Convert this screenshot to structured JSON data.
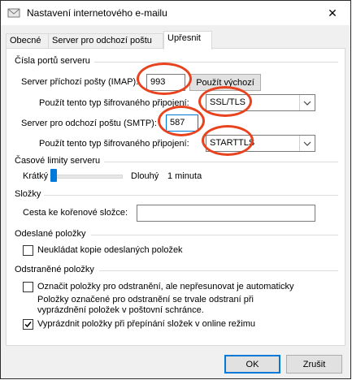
{
  "window": {
    "title": "Nastavení internetového e-mailu"
  },
  "tabs": [
    {
      "label": "Obecné"
    },
    {
      "label": "Server pro odchozí poštu"
    },
    {
      "label": "Upřesnit"
    }
  ],
  "ports_group": {
    "heading": "Čísla portů serveru",
    "incoming_label": "Server příchozí pošty (IMAP):",
    "incoming_value": "993",
    "use_default_label": "Použít výchozí",
    "incoming_encryption_label": "Použít tento typ šifrovaného připojení:",
    "incoming_encryption_value": "SSL/TLS",
    "outgoing_label": "Server pro odchozí poštu (SMTP):",
    "outgoing_value": "587",
    "outgoing_encryption_label": "Použít tento typ šifrovaného připojení:",
    "outgoing_encryption_value": "STARTTLS"
  },
  "timeouts_group": {
    "heading": "Časové limity serveru",
    "short_label": "Krátký",
    "long_label": "Dlouhý",
    "value_text": "1 minuta",
    "slider_fraction": 0.0
  },
  "folders_group": {
    "heading": "Složky",
    "root_path_label": "Cesta ke kořenové složce:",
    "root_path_value": ""
  },
  "sent_group": {
    "heading": "Odeslané položky",
    "no_copy_label": "Neukládat kopie odeslaných položek",
    "no_copy_checked": false
  },
  "deleted_group": {
    "heading": "Odstraněné položky",
    "mark_label": "Označit položky pro odstranění, ale nepřesunovat je automaticky",
    "mark_checked": false,
    "note_line1": "Položky označené pro odstranění se trvale odstraní při",
    "note_line2": "vyprázdnění položek v poštovní schránce.",
    "purge_label": "Vyprázdnit položky při přepínání složek v online režimu",
    "purge_checked": true
  },
  "footer": {
    "ok_label": "OK",
    "cancel_label": "Zrušit"
  },
  "icons": {
    "app": "envelope-icon",
    "close": "close-icon",
    "dropdown": "chevron-down-icon",
    "check": "checkmark-icon"
  },
  "colors": {
    "accent": "#0078d7",
    "annotation": "#e8421f"
  }
}
